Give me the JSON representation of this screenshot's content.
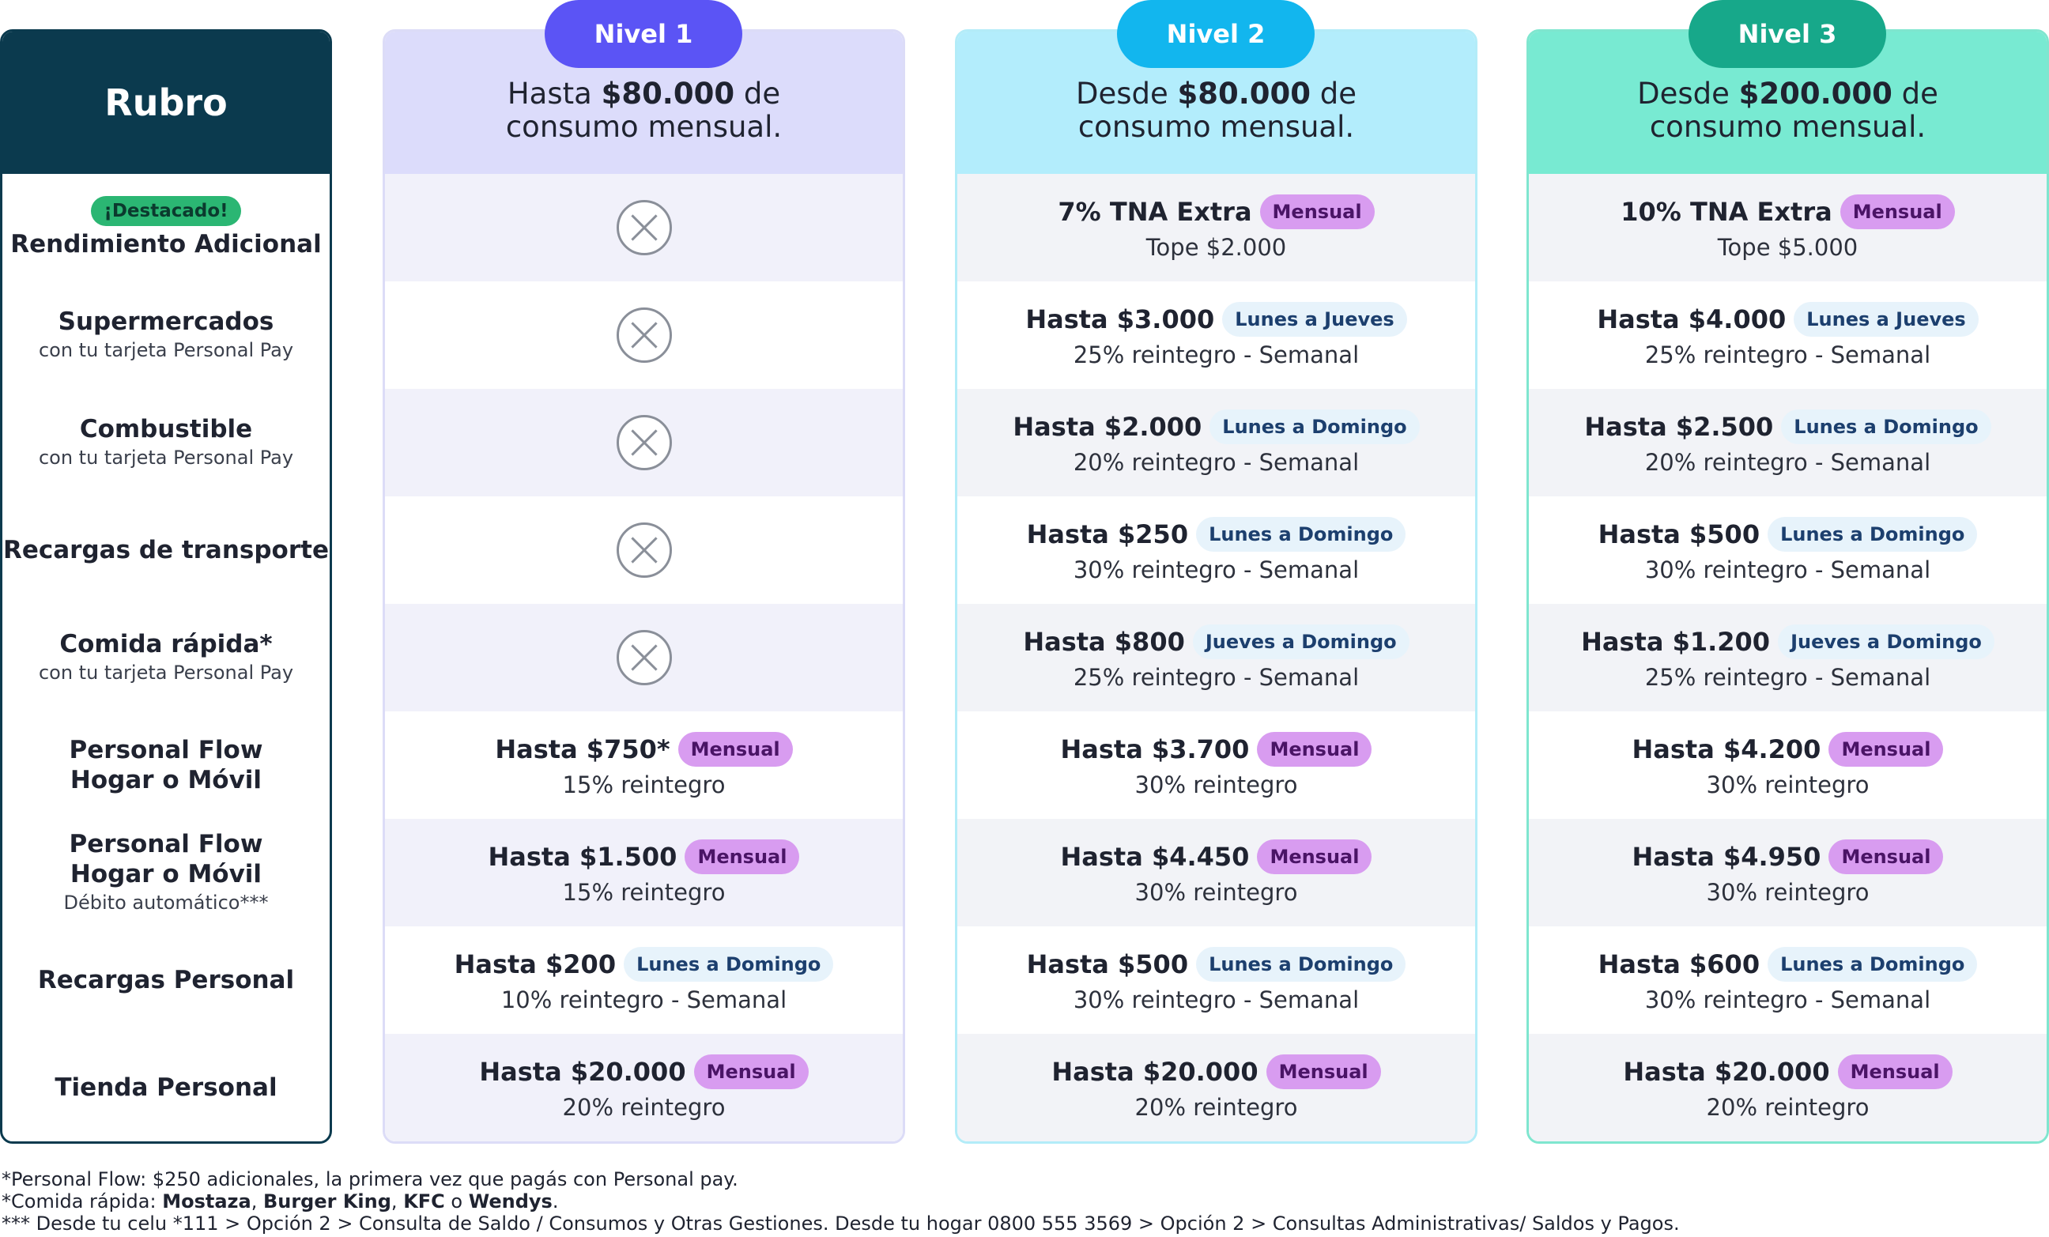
{
  "rubro": {
    "title": "Rubro",
    "badge": "¡Destacado!",
    "rows": [
      {
        "main": "Rendimiento Adicional",
        "sub": ""
      },
      {
        "main": "Supermercados",
        "sub": "con tu tarjeta Personal Pay"
      },
      {
        "main": "Combustible",
        "sub": "con tu tarjeta Personal Pay"
      },
      {
        "main": "Recargas de transporte",
        "sub": ""
      },
      {
        "main": "Comida rápida*",
        "sub": "con tu tarjeta Personal Pay"
      },
      {
        "main": "Personal Flow",
        "main2": "Hogar o Móvil",
        "sub": ""
      },
      {
        "main": "Personal Flow",
        "main2": "Hogar o Móvil",
        "sub": "Débito automático***"
      },
      {
        "main": "Recargas Personal",
        "sub": ""
      },
      {
        "main": "Tienda Personal",
        "sub": ""
      }
    ]
  },
  "levels": [
    {
      "tab": "Nivel 1",
      "head_pre": "Hasta",
      "head_amount": "$80.000",
      "head_post": "de",
      "head_line2": "consumo mensual.",
      "cells": [
        {
          "none": true
        },
        {
          "none": true
        },
        {
          "none": true
        },
        {
          "none": true
        },
        {
          "none": true
        },
        {
          "amount": "Hasta $750*",
          "pill": "Mensual",
          "detail": "15% reintegro"
        },
        {
          "amount": "Hasta $1.500",
          "pill": "Mensual",
          "detail": "15% reintegro"
        },
        {
          "amount": "Hasta $200",
          "pill": "Lunes a Domingo",
          "detail": "10% reintegro - Semanal"
        },
        {
          "amount": "Hasta $20.000",
          "pill": "Mensual",
          "detail": "20% reintegro"
        }
      ]
    },
    {
      "tab": "Nivel 2",
      "head_pre": "Desde",
      "head_amount": "$80.000",
      "head_post": "de",
      "head_line2": "consumo mensual.",
      "cells": [
        {
          "amount": "7% TNA Extra",
          "pill": "Mensual",
          "detail": "Tope $2.000"
        },
        {
          "amount": "Hasta $3.000",
          "pill": "Lunes a Jueves",
          "detail": "25% reintegro - Semanal"
        },
        {
          "amount": "Hasta $2.000",
          "pill": "Lunes a Domingo",
          "detail": "20% reintegro - Semanal"
        },
        {
          "amount": "Hasta $250",
          "pill": "Lunes a Domingo",
          "detail": "30% reintegro - Semanal"
        },
        {
          "amount": "Hasta $800",
          "pill": "Jueves a Domingo",
          "detail": "25% reintegro - Semanal"
        },
        {
          "amount": "Hasta $3.700",
          "pill": "Mensual",
          "detail": "30% reintegro"
        },
        {
          "amount": "Hasta $4.450",
          "pill": "Mensual",
          "detail": "30% reintegro"
        },
        {
          "amount": "Hasta $500",
          "pill": "Lunes a Domingo",
          "detail": "30% reintegro - Semanal"
        },
        {
          "amount": "Hasta $20.000",
          "pill": "Mensual",
          "detail": "20% reintegro"
        }
      ]
    },
    {
      "tab": "Nivel 3",
      "head_pre": "Desde",
      "head_amount": "$200.000",
      "head_post": "de",
      "head_line2": "consumo mensual.",
      "cells": [
        {
          "amount": "10% TNA Extra",
          "pill": "Mensual",
          "detail": "Tope $5.000"
        },
        {
          "amount": "Hasta $4.000",
          "pill": "Lunes a Jueves",
          "detail": "25% reintegro - Semanal"
        },
        {
          "amount": "Hasta $2.500",
          "pill": "Lunes a Domingo",
          "detail": "20% reintegro - Semanal"
        },
        {
          "amount": "Hasta $500",
          "pill": "Lunes a Domingo",
          "detail": "30% reintegro - Semanal"
        },
        {
          "amount": "Hasta $1.200",
          "pill": "Jueves a Domingo",
          "detail": "25% reintegro - Semanal"
        },
        {
          "amount": "Hasta $4.200",
          "pill": "Mensual",
          "detail": "30% reintegro"
        },
        {
          "amount": "Hasta $4.950",
          "pill": "Mensual",
          "detail": "30% reintegro"
        },
        {
          "amount": "Hasta $600",
          "pill": "Lunes a Domingo",
          "detail": "30% reintegro - Semanal"
        },
        {
          "amount": "Hasta $20.000",
          "pill": "Mensual",
          "detail": "20% reintegro"
        }
      ]
    }
  ],
  "footnotes": {
    "line1": "*Personal Flow: $250 adicionales,  la primera vez que pagás con Personal pay.",
    "line2_prefix": "*Comida rápida: ",
    "line2_b1": "Mostaza",
    "line2_sep1": ", ",
    "line2_b2": "Burger King",
    "line2_sep2": ", ",
    "line2_b3": "KFC",
    "line2_sep3": " o ",
    "line2_b4": "Wendys",
    "line2_end": ".",
    "line3": "*** Desde tu celu *111 > Opción 2 > Consulta de Saldo / Consumos y Otras Gestiones. Desde tu hogar 0800 555 3569 > Opción 2  > Consultas Administrativas/ Saldos y Pagos."
  },
  "colors": {
    "rubro_header": "#0b3a4e",
    "nivel1": "#5b54f5",
    "nivel2": "#12b6ee",
    "nivel3": "#17a88a",
    "pill_mensual": "#d89cf0",
    "pill_days": "#e7f3fb",
    "badge_destacado": "#2bb673"
  },
  "icons": {
    "not_available": "x-circle-icon"
  }
}
